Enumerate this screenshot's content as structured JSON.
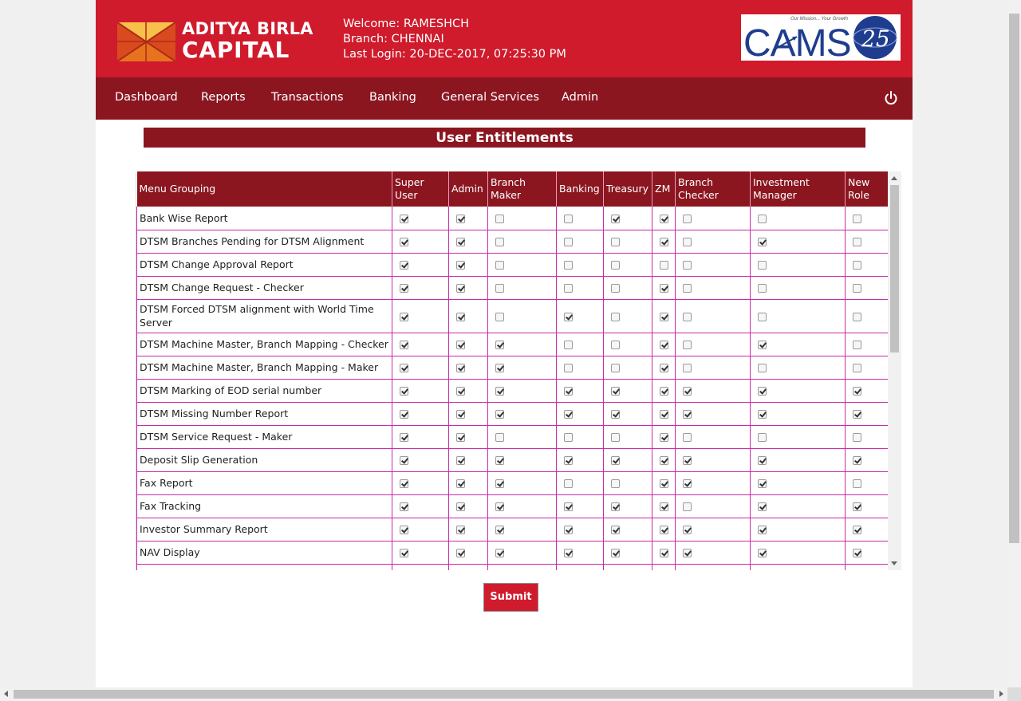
{
  "header": {
    "brand_line1": "ADITYA BIRLA",
    "brand_line2": "CAPITAL",
    "welcome": "Welcome: RAMESHCH",
    "branch": "Branch: CHENNAI",
    "last_login": "Last Login: 20-DEC-2017, 07:25:30 PM",
    "partner_logo": "CAMS",
    "partner_tagline": "Our Mission... Your Growth",
    "partner_badge": "25"
  },
  "nav": {
    "items": [
      "Dashboard",
      "Reports",
      "Transactions",
      "Banking",
      "General Services",
      "Admin"
    ],
    "power_icon": "power-icon"
  },
  "page_title": "User Entitlements",
  "table": {
    "headers": [
      "Menu Grouping",
      "Super User",
      "Admin",
      "Branch Maker",
      "Banking",
      "Treasury",
      "ZM",
      "Branch Checker",
      "Investment Manager",
      "New Role"
    ],
    "rows": [
      {
        "label": "Bank Wise Report",
        "checks": [
          1,
          1,
          0,
          0,
          1,
          1,
          0,
          0,
          0
        ]
      },
      {
        "label": "DTSM Branches Pending for DTSM Alignment",
        "checks": [
          1,
          1,
          0,
          0,
          0,
          1,
          0,
          1,
          0
        ]
      },
      {
        "label": "DTSM Change Approval Report",
        "checks": [
          1,
          1,
          0,
          0,
          0,
          0,
          0,
          0,
          0
        ]
      },
      {
        "label": "DTSM Change Request - Checker",
        "checks": [
          1,
          1,
          0,
          0,
          0,
          1,
          0,
          0,
          0
        ]
      },
      {
        "label": "DTSM Forced DTSM alignment with World Time Server",
        "checks": [
          1,
          1,
          0,
          1,
          0,
          1,
          0,
          0,
          0
        ]
      },
      {
        "label": "DTSM Machine Master, Branch Mapping - Checker",
        "checks": [
          1,
          1,
          1,
          0,
          0,
          1,
          0,
          1,
          0
        ]
      },
      {
        "label": "DTSM Machine Master, Branch Mapping - Maker",
        "checks": [
          1,
          1,
          1,
          0,
          0,
          1,
          0,
          0,
          0
        ]
      },
      {
        "label": "DTSM Marking of EOD serial number",
        "checks": [
          1,
          1,
          1,
          1,
          1,
          1,
          1,
          1,
          1
        ]
      },
      {
        "label": "DTSM Missing Number Report",
        "checks": [
          1,
          1,
          1,
          1,
          1,
          1,
          1,
          1,
          1
        ]
      },
      {
        "label": "DTSM Service Request - Maker",
        "checks": [
          1,
          1,
          0,
          0,
          0,
          1,
          0,
          0,
          0
        ]
      },
      {
        "label": "Deposit Slip Generation",
        "checks": [
          1,
          1,
          1,
          1,
          1,
          1,
          1,
          1,
          1
        ]
      },
      {
        "label": "Fax Report",
        "checks": [
          1,
          1,
          1,
          0,
          0,
          1,
          1,
          1,
          0
        ]
      },
      {
        "label": "Fax Tracking",
        "checks": [
          1,
          1,
          1,
          1,
          1,
          1,
          0,
          1,
          1
        ]
      },
      {
        "label": "Investor Summary Report",
        "checks": [
          1,
          1,
          1,
          1,
          1,
          1,
          1,
          1,
          1
        ]
      },
      {
        "label": "NAV Display",
        "checks": [
          1,
          1,
          1,
          1,
          1,
          1,
          1,
          1,
          1
        ]
      },
      {
        "label": "",
        "checks": [
          0,
          0,
          0,
          0,
          0,
          0,
          0,
          0,
          0
        ]
      }
    ]
  },
  "submit_label": "Submit",
  "colors": {
    "header_red": "#cf1b2c",
    "nav_maroon": "#8b1620",
    "grid_border": "#c92aa9"
  }
}
